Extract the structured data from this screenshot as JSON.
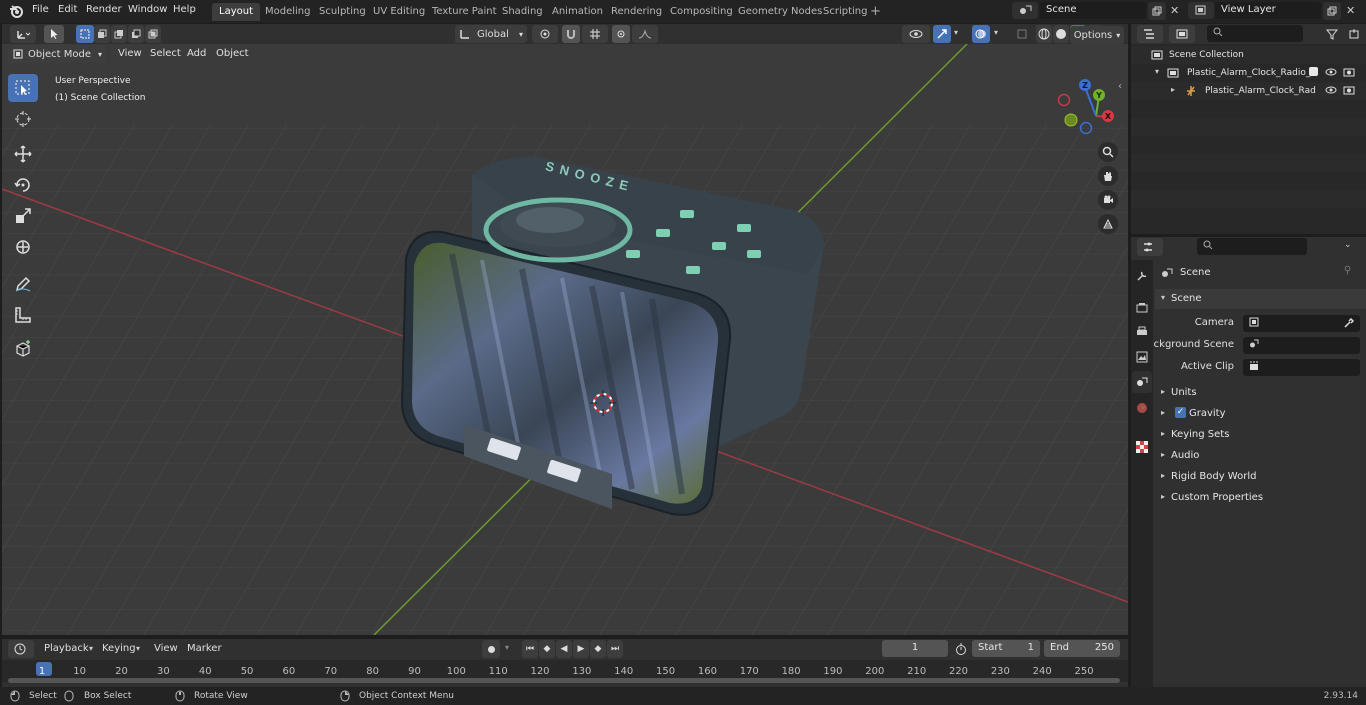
{
  "topbar": {
    "menus": [
      "File",
      "Edit",
      "Render",
      "Window",
      "Help"
    ],
    "workspaces": [
      "Layout",
      "Modeling",
      "Sculpting",
      "UV Editing",
      "Texture Paint",
      "Shading",
      "Animation",
      "Rendering",
      "Compositing",
      "Geometry Nodes",
      "Scripting"
    ],
    "active_workspace": "Layout",
    "scene_name": "Scene",
    "view_layer": "View Layer"
  },
  "viewport_header": {
    "mode": "Object Mode",
    "menus": [
      "View",
      "Select",
      "Add",
      "Object"
    ],
    "transform_orientation": "Global",
    "options_label": "Options"
  },
  "viewport": {
    "perspective_label": "User Perspective",
    "collection_label": "(1) Scene Collection",
    "object_text": "SNOOZE",
    "gizmo_axes": [
      "X",
      "Y",
      "Z"
    ],
    "colors": {
      "background": "#393939",
      "grid": "#444444",
      "x_axis": "#9c3b45",
      "y_axis": "#6b9a2e",
      "accent": "#4772b3"
    }
  },
  "toolbar": {
    "tools": [
      "select-box",
      "cursor",
      "move",
      "rotate",
      "scale",
      "transform",
      "annotate",
      "measure",
      "add-cube"
    ]
  },
  "outliner": {
    "root": "Scene Collection",
    "items": [
      {
        "label": "Plastic_Alarm_Clock_Radio_D",
        "level": 1
      },
      {
        "label": "Plastic_Alarm_Clock_Rad",
        "level": 2
      }
    ]
  },
  "properties": {
    "header_title": "Scene",
    "panel_title": "Scene",
    "fields": [
      {
        "label": "Camera"
      },
      {
        "label": "Background Scene"
      },
      {
        "label": "Active Clip"
      }
    ],
    "sections": [
      "Units",
      "Gravity",
      "Keying Sets",
      "Audio",
      "Rigid Body World",
      "Custom Properties"
    ],
    "gravity_checked": true
  },
  "timeline": {
    "menus": [
      "Playback",
      "Keying",
      "View",
      "Marker"
    ],
    "current_frame": "1",
    "start_label": "Start",
    "start_value": "1",
    "end_label": "End",
    "end_value": "250",
    "ruler": [
      "1",
      "10",
      "20",
      "30",
      "40",
      "50",
      "60",
      "70",
      "80",
      "90",
      "100",
      "110",
      "120",
      "130",
      "140",
      "150",
      "160",
      "170",
      "180",
      "190",
      "200",
      "210",
      "220",
      "230",
      "240",
      "250"
    ]
  },
  "statusbar": {
    "select": "Select",
    "box_select": "Box Select",
    "rotate_view": "Rotate View",
    "context_menu": "Object Context Menu",
    "version": "2.93.14"
  }
}
